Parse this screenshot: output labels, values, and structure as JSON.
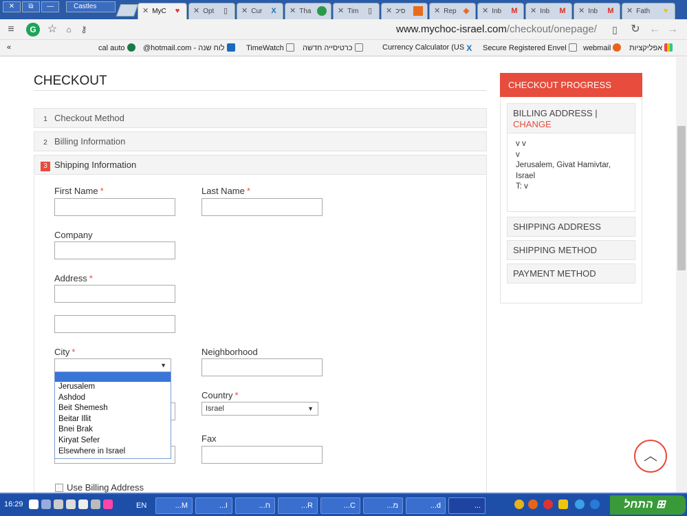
{
  "browser": {
    "castles_label": "Castles",
    "tabs": [
      {
        "label": "MyC",
        "icon": "heart-icon",
        "color": "#e0343c",
        "active": true
      },
      {
        "label": "Opt",
        "icon": "page-icon"
      },
      {
        "label": "Cur",
        "icon": "x-icon",
        "color": "#1a73b8"
      },
      {
        "label": "Tha",
        "icon": "globe-icon",
        "color": "#2a9a4a"
      },
      {
        "label": "Tim",
        "icon": "page-icon"
      },
      {
        "label": "סיכ",
        "icon": "square-icon",
        "color": "#e86c1a"
      },
      {
        "label": "Rep",
        "icon": "magento-icon",
        "color": "#e8641a"
      },
      {
        "label": "Inb",
        "icon": "gmail-icon",
        "color": "#d93025"
      },
      {
        "label": "Inb",
        "icon": "gmail-icon",
        "color": "#d93025"
      },
      {
        "label": "Inb",
        "icon": "gmail-icon",
        "color": "#d93025"
      },
      {
        "label": "Fath",
        "icon": "heart-icon",
        "color": "#e8c41a"
      }
    ],
    "url_domain": "www.mychoc-israel.com",
    "url_path": "/checkout/onepage/",
    "bookmarks": {
      "chevron": "«",
      "cal_auto": "cal auto",
      "hotmail": "@hotmail.com - לוח שנה",
      "timewatch": "TimeWatch",
      "kartisiya": "כרטיסייה חדשה",
      "currency": "Currency Calculator (US",
      "secure": "Secure Registered Envel",
      "webmail": "webmail",
      "apps": "אפליקציות"
    }
  },
  "checkout": {
    "title": "CHECKOUT",
    "steps": [
      {
        "num": "1",
        "label": "Checkout Method"
      },
      {
        "num": "2",
        "label": "Billing Information"
      },
      {
        "num": "3",
        "label": "Shipping Information"
      }
    ],
    "form": {
      "first_name": "First Name",
      "last_name": "Last Name",
      "company": "Company",
      "address": "Address",
      "city": "City",
      "neighborhood": "Neighborhood",
      "country": "Country",
      "country_value": "Israel",
      "fax": "Fax",
      "use_billing": "Use Billing Address",
      "required_mark": "*"
    },
    "city_options": [
      "",
      "Jerusalem",
      "Ashdod",
      "Beit Shemesh",
      "Beitar Illit",
      "Bnei Brak",
      "Kiryat Sefer",
      "Elsewhere in Israel"
    ]
  },
  "progress": {
    "header": "CHECKOUT PROGRESS",
    "billing_title": "BILLING ADDRESS",
    "separator": "|",
    "change": "CHANGE",
    "billing_lines": [
      "v v",
      "v",
      "Jerusalem, Givat Hamivtar,",
      "Israel",
      "T: v"
    ],
    "shipping_address": "SHIPPING ADDRESS",
    "shipping_method": "SHIPPING METHOD",
    "payment_method": "PAYMENT METHOD"
  },
  "taskbar": {
    "clock": "16:29",
    "lang": "EN",
    "tasks": [
      "...M",
      "...I",
      "...ח",
      "...R",
      "...C",
      "...מ",
      "...d",
      "..."
    ],
    "start": "התחל"
  },
  "colors": {
    "accent": "#e74c3c",
    "taskbar": "#1d4fa8"
  }
}
